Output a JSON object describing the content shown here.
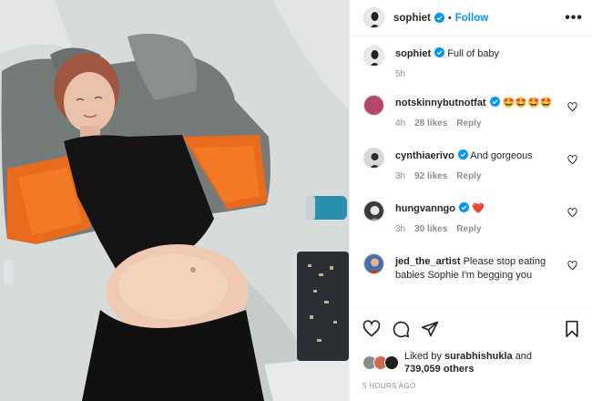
{
  "post": {
    "username": "sophiet",
    "follow_label": "Follow",
    "separator": "•",
    "more_label": "•••",
    "caption": "Full of baby",
    "caption_age": "5h",
    "liked_prefix": "Liked by",
    "liked_user": "surabhishukla",
    "liked_and": "and",
    "likes_count": "739,059 others",
    "timestamp": "5 HOURS AGO"
  },
  "comments": [
    {
      "user": "notskinnybutnotfat",
      "text": "🤩🤩🤩🤩",
      "age": "4h",
      "likes": "28 likes",
      "reply": "Reply",
      "avatar_color": "#b5476a"
    },
    {
      "user": "cynthiaerivo",
      "text": "And gorgeous",
      "age": "3h",
      "likes": "92 likes",
      "reply": "Reply",
      "avatar_color": "#d8d8d8"
    },
    {
      "user": "hungvanngo",
      "text": "❤️",
      "age": "3h",
      "likes": "30 likes",
      "reply": "Reply",
      "avatar_color": "#3a3a3a"
    },
    {
      "user": "jed_the_artist",
      "text": "Please stop eating babies Sophie I'm begging you",
      "avatar_color": "#4a6fa5"
    }
  ],
  "icons": [
    "verified-badge-icon",
    "heart-icon",
    "comment-icon",
    "share-icon",
    "bookmark-icon",
    "more-options-icon"
  ],
  "colors": {
    "link_blue": "#0095f6",
    "text": "#262626",
    "muted": "#8e8e8e",
    "divider": "#efefef"
  }
}
